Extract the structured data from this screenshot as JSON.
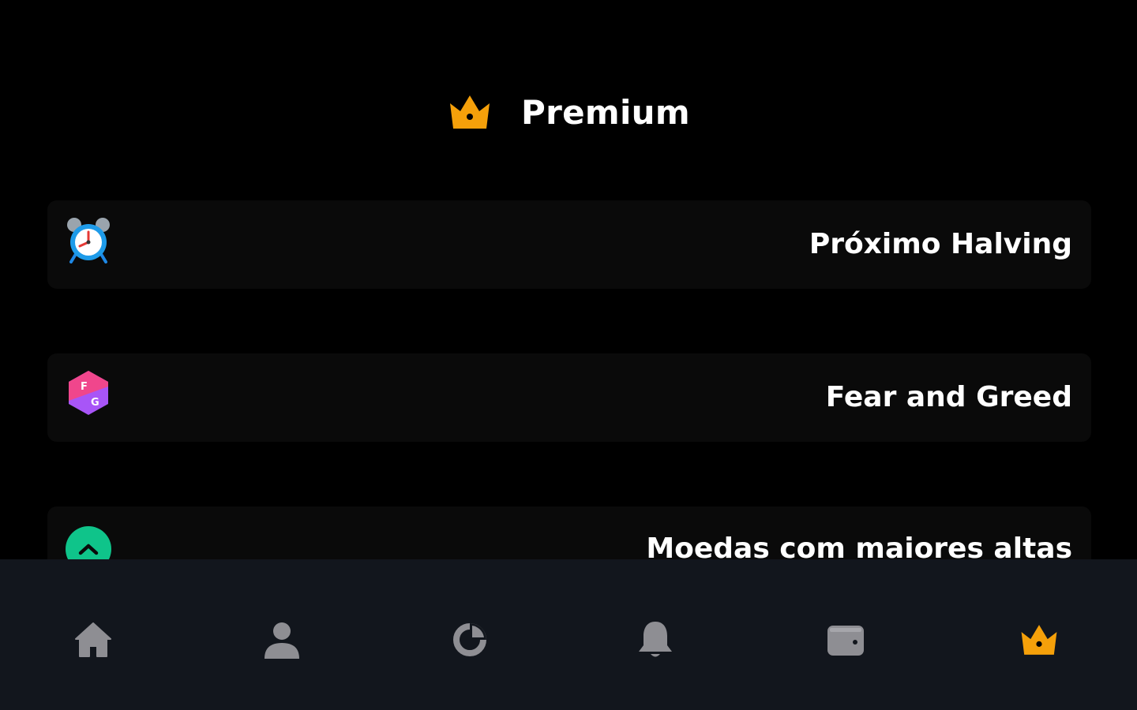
{
  "header": {
    "title": "Premium",
    "icon": "crown-icon",
    "icon_color": "#f5a00a"
  },
  "menu": {
    "items": [
      {
        "label": "Próximo Halving",
        "icon": "alarm-clock-icon"
      },
      {
        "label": "Fear and Greed",
        "icon": "fear-greed-icon"
      },
      {
        "label": "Moedas com maiores altas",
        "icon": "chevron-up-circle-icon",
        "icon_color": "#0fc48a"
      }
    ]
  },
  "tabbar": {
    "tabs": [
      {
        "name": "home",
        "icon": "home-icon"
      },
      {
        "name": "profile",
        "icon": "user-icon"
      },
      {
        "name": "portfolio",
        "icon": "pie-chart-icon"
      },
      {
        "name": "alerts",
        "icon": "bell-icon"
      },
      {
        "name": "wallet",
        "icon": "wallet-icon"
      },
      {
        "name": "premium",
        "icon": "crown-icon",
        "active": true
      }
    ],
    "inactive_color": "#8e8e93",
    "active_color": "#f5a00a"
  },
  "colors": {
    "background": "#000000",
    "card": "#0a0a0a",
    "tabbar": "#12161d"
  }
}
